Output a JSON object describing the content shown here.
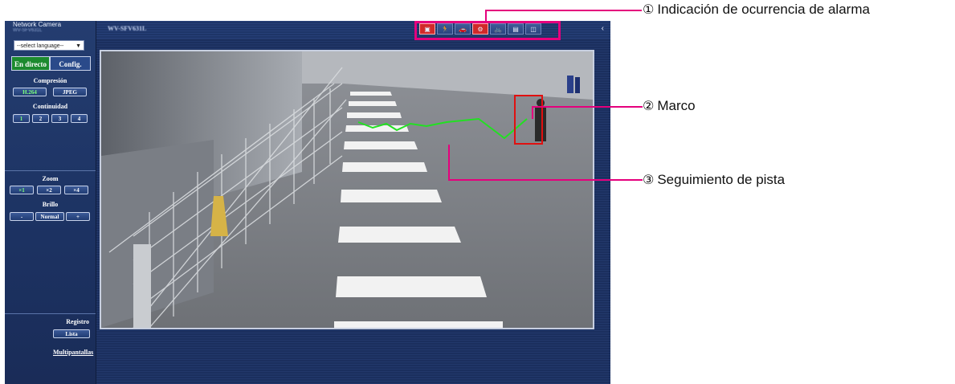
{
  "sidebar": {
    "title": "Network Camera",
    "subtitle": "WV-SFV631L",
    "language_select": "--select language--",
    "tabs": {
      "live": "En directo",
      "config": "Config."
    },
    "compression": {
      "label": "Compresión",
      "h264": "H.264",
      "jpeg": "JPEG"
    },
    "stream": {
      "label": "Continuidad",
      "items": [
        "1",
        "2",
        "3",
        "4"
      ]
    },
    "zoom": {
      "label": "Zoom",
      "items": [
        "×1",
        "×2",
        "×4"
      ]
    },
    "brightness": {
      "label": "Brillo",
      "minus": "-",
      "normal": "Normal",
      "plus": "+"
    },
    "log": {
      "label": "Registro",
      "list": "Lista"
    },
    "multiscreen": "Multipantallas"
  },
  "topbar": {
    "model": "WV-SFV631L",
    "alarm_icons": [
      "alarm-icon",
      "person-icon",
      "car-icon",
      "bike-icon",
      "cyclist-icon",
      "sign-icon",
      "camera-icon"
    ],
    "active_alarm": [
      0,
      3
    ]
  },
  "annotations": [
    {
      "num": "①",
      "text": "Indicación de ocurrencia de alarma"
    },
    {
      "num": "②",
      "text": "Marco"
    },
    {
      "num": "③",
      "text": "Seguimiento de pista"
    }
  ],
  "colors": {
    "highlight": "#e5007d",
    "track": "#22e022",
    "frame": "#e01010",
    "live_tab": "#1c8a2e"
  }
}
